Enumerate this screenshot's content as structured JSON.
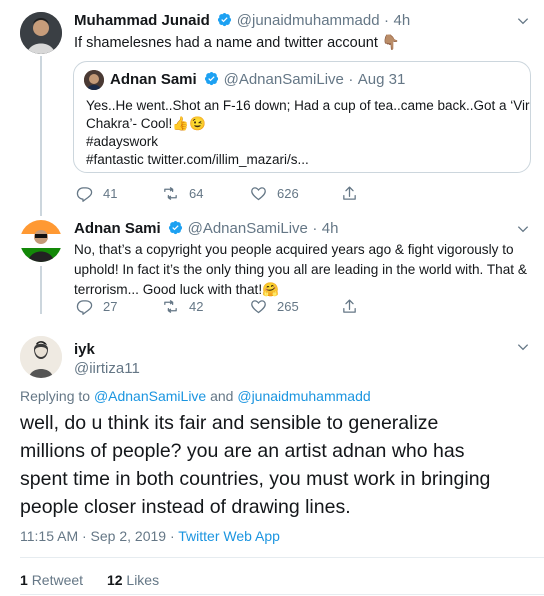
{
  "tweet1": {
    "name": "Muhammad Junaid",
    "handle": "@junaidmuhammadd",
    "dot": "·",
    "time": "4h",
    "text": "If shamelesnes had a name and twitter account 👇🏽",
    "quote": {
      "name": "Adnan Sami",
      "handle": "@AdnanSamiLive",
      "dot": "·",
      "time": "Aug 31",
      "line1": "Yes..He went..Shot an F-16 down; Had a cup of tea..came back..Got a ‘Vir",
      "line2": "Chakra’- Cool!👍😉",
      "line3": "#adayswork",
      "line4": "#fantastic twitter.com/illim_mazari/s..."
    },
    "replies": "41",
    "retweets": "64",
    "likes": "626"
  },
  "tweet2": {
    "name": "Adnan Sami",
    "handle": "@AdnanSamiLive",
    "dot": "·",
    "time": "4h",
    "line1": "No, that’s a copyright you people acquired years ago & fight vigorously to",
    "line2": "uphold! In fact it’s the only thing you all are leading in the world with. That &",
    "line3": "terrorism... Good luck with that!🤗",
    "replies": "27",
    "retweets": "42",
    "likes": "265"
  },
  "main": {
    "name": "iyk",
    "handle": "@iirtiza11",
    "replying_prefix": "Replying to",
    "reply_to1": "@AdnanSamiLive",
    "and": "and",
    "reply_to2": "@junaidmuhammadd",
    "line1": "well, do u think its fair and sensible to generalize",
    "line2": "millions of people? you are an artist adnan who has",
    "line3": "spent time in both countries, you must work in bringing",
    "line4": "people closer instead of drawing lines.",
    "timestamp": "11:15 AM · Sep 2, 2019 ·",
    "source": "Twitter Web App",
    "retweets_count": "1",
    "retweets_label": "Retweet",
    "likes_count": "12",
    "likes_label": "Likes"
  },
  "colors": {
    "accent": "#1b95e0",
    "verified": "#1da1f2",
    "secondary_text": "#657786",
    "border": "#ccd6dd"
  },
  "icons": [
    "verified-badge-icon",
    "chevron-down-icon",
    "reply-icon",
    "retweet-icon",
    "like-icon",
    "share-icon"
  ]
}
